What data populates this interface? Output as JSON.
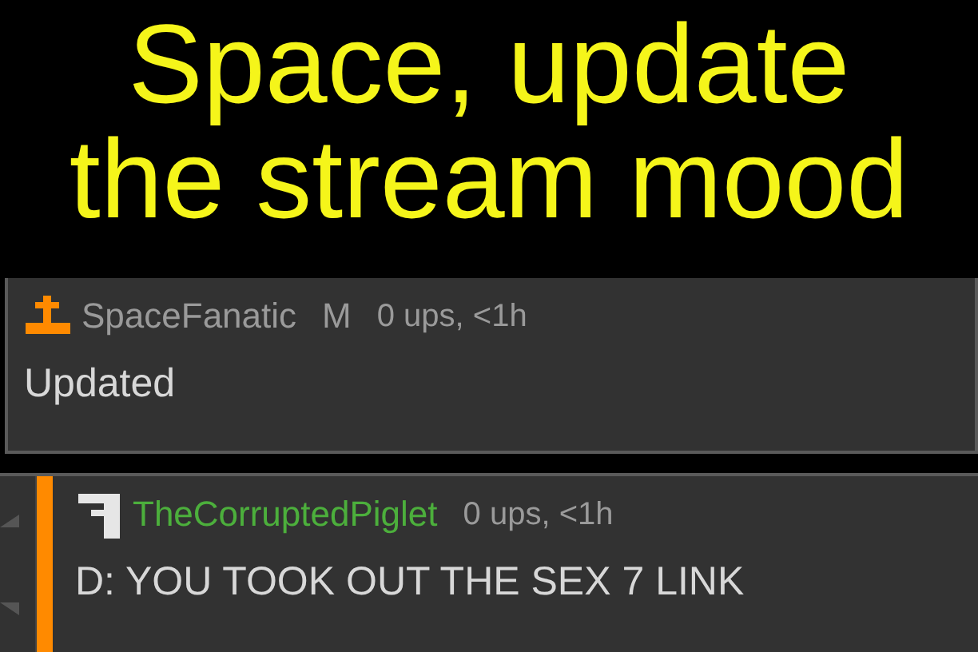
{
  "caption": [
    "Space, update",
    "the stream mood"
  ],
  "comments": [
    {
      "kind": "top",
      "user": "SpaceFanatic",
      "color": "#9a9a9a",
      "badge": "M",
      "meta": "0 ups, <1h",
      "text": "Updated"
    },
    {
      "kind": "reply",
      "user": "TheCorruptedPiglet",
      "color": "#4caf3c",
      "meta": "0 ups, <1h",
      "text": "D: YOU TOOK OUT THE SEX 7 LINK"
    }
  ]
}
